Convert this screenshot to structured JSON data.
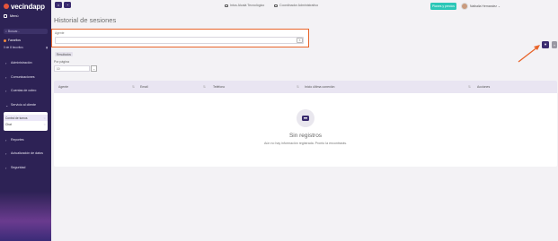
{
  "sidebar": {
    "logo": "vecindapp",
    "menu_label": "Menú",
    "search_placeholder": "Buscar...",
    "favorites_label": "Favoritos",
    "favorites_count": "0 de 8 favoritos",
    "items": [
      {
        "label": "Administración"
      },
      {
        "label": "Comunicaciones"
      },
      {
        "label": "Cuentas de cobro"
      },
      {
        "label": "Servicio al cliente"
      },
      {
        "label": "Reportes"
      },
      {
        "label": "Actualización de datos"
      },
      {
        "label": "Seguridad"
      }
    ],
    "submenu": [
      {
        "label": "Control de turnos"
      },
      {
        "label": "Chat"
      }
    ]
  },
  "topbar": {
    "link1": "Intus Alcalá Tecnológico",
    "link2": "Coordinador Administrativo",
    "pay_label": "Planes y precios",
    "user_name": "Nathalia Hernandez"
  },
  "main": {
    "title": "Historial de sesiones",
    "filter_label": "Agente",
    "clear_symbol": "×",
    "results_badge": "Resultados",
    "perpage_label": "Por página",
    "perpage_value": "10"
  },
  "table": {
    "columns": [
      "Agente",
      "Email",
      "Teléfono",
      "Inicio última conexión",
      "Acciones"
    ],
    "empty_title": "Sin registros",
    "empty_message": "Aún no hay información registrada. Pronto la encontrarás."
  },
  "colors": {
    "sidebar": "#2d2255",
    "accent": "#3a2b6e",
    "highlight": "#e8642a",
    "teal": "#2cc7b7"
  }
}
